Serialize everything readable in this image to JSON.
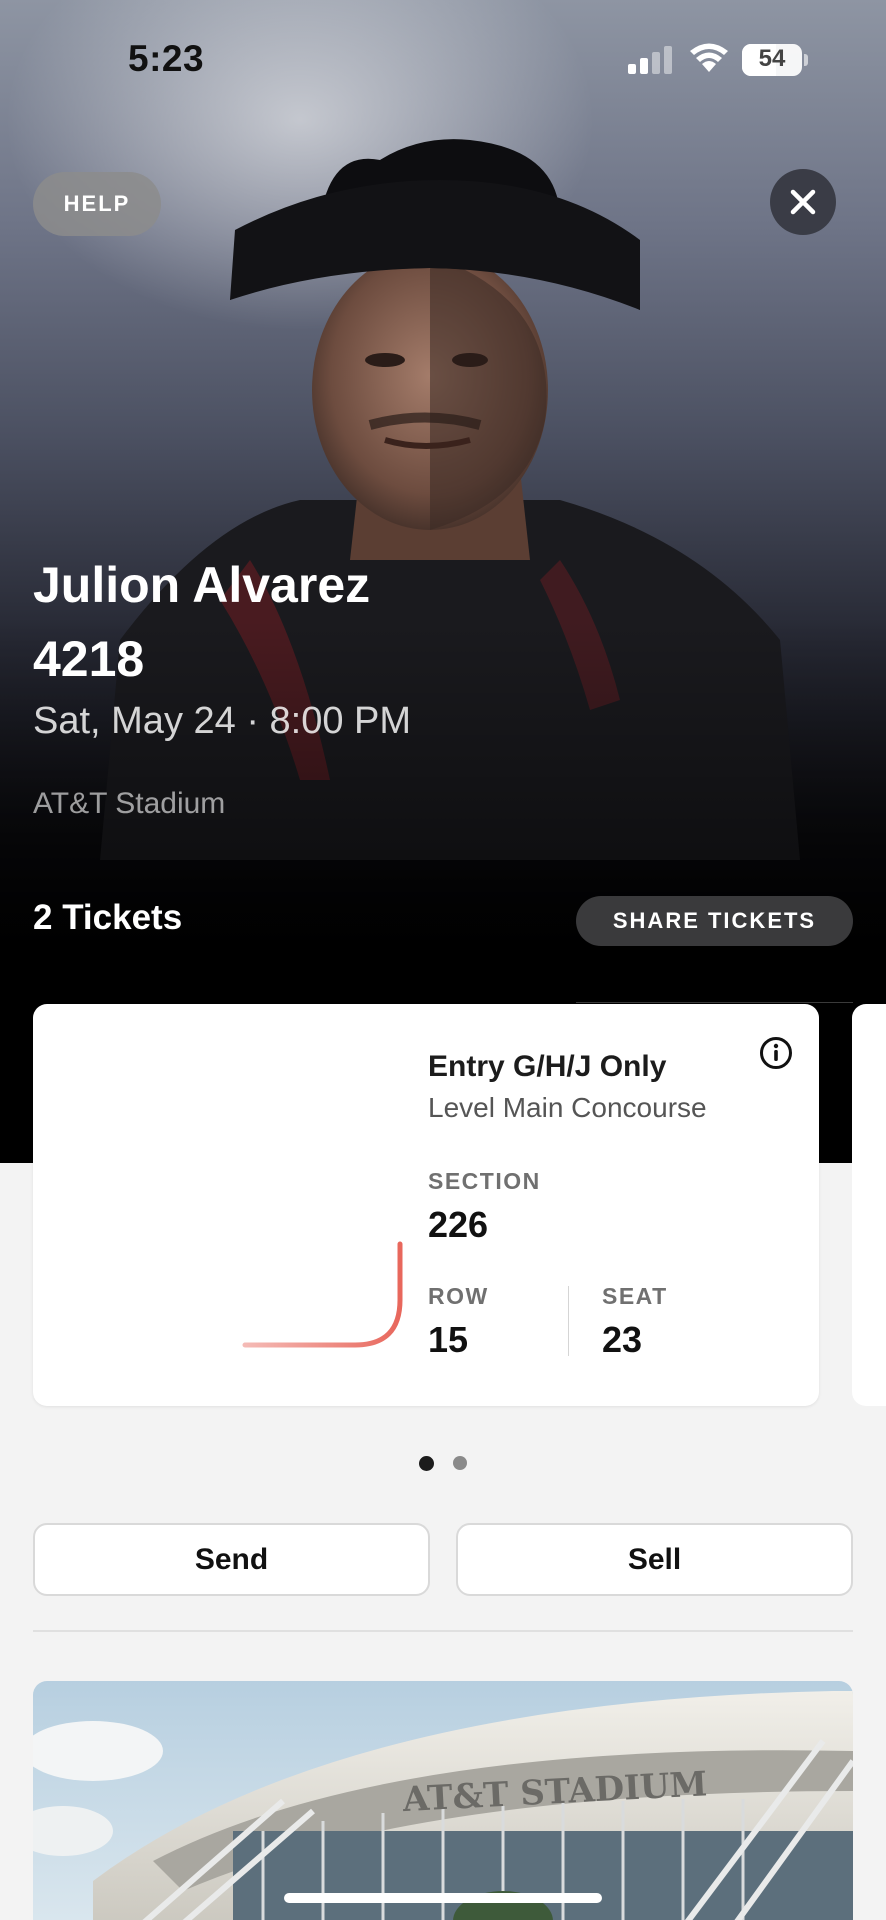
{
  "status_bar": {
    "time": "5:23",
    "battery": "54",
    "icons": [
      "cellular-signal-icon",
      "wifi-icon",
      "battery-icon"
    ]
  },
  "header": {
    "help_label": "HELP",
    "close_icon": "close-icon"
  },
  "event": {
    "title_line1": "Julion Alvarez",
    "title_line2": "4218",
    "date_time": "Sat, May 24 · 8:00 PM",
    "venue": "AT&T Stadium"
  },
  "tickets": {
    "count_label": "2 Tickets",
    "share_label": "SHARE TICKETS",
    "current_index": 1,
    "total_pages": 2,
    "card": {
      "entry": "Entry G/H/J Only",
      "level": "Level Main Concourse",
      "section_label": "SECTION",
      "section_value": "226",
      "row_label": "ROW",
      "row_value": "15",
      "seat_label": "SEAT",
      "seat_value": "23",
      "info_icon": "info-icon"
    }
  },
  "actions": {
    "send_label": "Send",
    "sell_label": "Sell"
  },
  "venue_image": {
    "sign_text": "AT&T STADIUM"
  },
  "colors": {
    "loader_accent": "#e8675c",
    "hero_dark": "#000000",
    "page_bg": "#f3f3f3",
    "share_button_bg": "#3a3a3c"
  }
}
